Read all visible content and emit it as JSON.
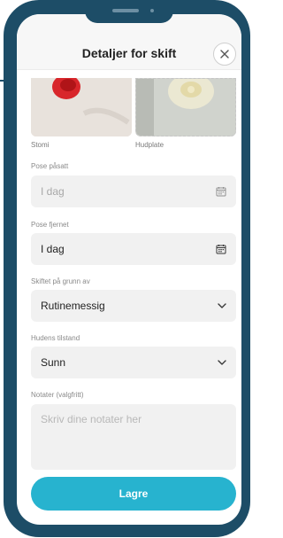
{
  "header": {
    "title": "Detaljer for skift"
  },
  "photos": [
    {
      "label": "Stomi"
    },
    {
      "label": "Hudplate"
    }
  ],
  "form": {
    "pose_applied": {
      "label": "Pose påsatt",
      "value": "I dag"
    },
    "pose_removed": {
      "label": "Pose fjernet",
      "value": "I dag"
    },
    "reason": {
      "label": "Skiftet på grunn av",
      "value": "Rutinemessig"
    },
    "skin": {
      "label": "Hudens tilstand",
      "value": "Sunn"
    },
    "notes": {
      "label": "Notater (valgfritt)",
      "placeholder": "Skriv dine notater her"
    }
  },
  "actions": {
    "save_label": "Lagre"
  },
  "colors": {
    "frame": "#1d4d67",
    "accent": "#27b3cf"
  }
}
